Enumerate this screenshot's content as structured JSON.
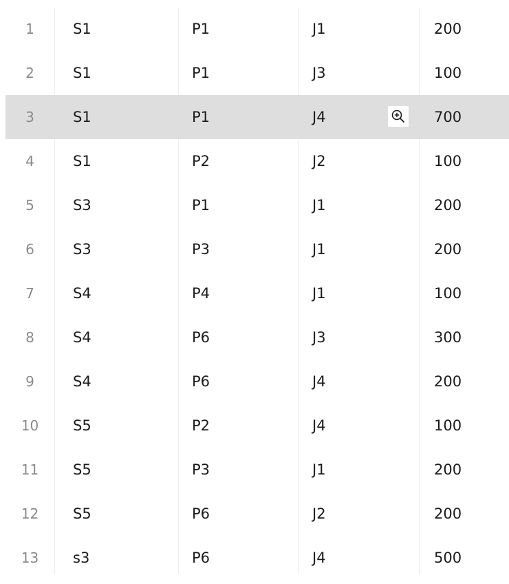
{
  "table": {
    "selected_row": 3,
    "rows": [
      {
        "num": "1",
        "c1": "S1",
        "c2": "P1",
        "c3": "J1",
        "c4": "200"
      },
      {
        "num": "2",
        "c1": "S1",
        "c2": "P1",
        "c3": "J3",
        "c4": "100"
      },
      {
        "num": "3",
        "c1": "S1",
        "c2": "P1",
        "c3": "J4",
        "c4": "700",
        "icon": "zoom-in-icon"
      },
      {
        "num": "4",
        "c1": "S1",
        "c2": "P2",
        "c3": "J2",
        "c4": "100"
      },
      {
        "num": "5",
        "c1": "S3",
        "c2": "P1",
        "c3": "J1",
        "c4": "200"
      },
      {
        "num": "6",
        "c1": "S3",
        "c2": "P3",
        "c3": "J1",
        "c4": "200"
      },
      {
        "num": "7",
        "c1": "S4",
        "c2": "P4",
        "c3": "J1",
        "c4": "100"
      },
      {
        "num": "8",
        "c1": "S4",
        "c2": "P6",
        "c3": "J3",
        "c4": "300"
      },
      {
        "num": "9",
        "c1": "S4",
        "c2": "P6",
        "c3": "J4",
        "c4": "200"
      },
      {
        "num": "10",
        "c1": "S5",
        "c2": "P2",
        "c3": "J4",
        "c4": "100"
      },
      {
        "num": "11",
        "c1": "S5",
        "c2": "P3",
        "c3": "J1",
        "c4": "200"
      },
      {
        "num": "12",
        "c1": "S5",
        "c2": "P6",
        "c3": "J2",
        "c4": "200"
      },
      {
        "num": "13",
        "c1": "s3",
        "c2": "P6",
        "c3": "J4",
        "c4": "500"
      }
    ]
  },
  "colors": {
    "selected_row_bg": "#dedede",
    "row_number": "#8a8a8a",
    "text": "#1b1b1b"
  }
}
